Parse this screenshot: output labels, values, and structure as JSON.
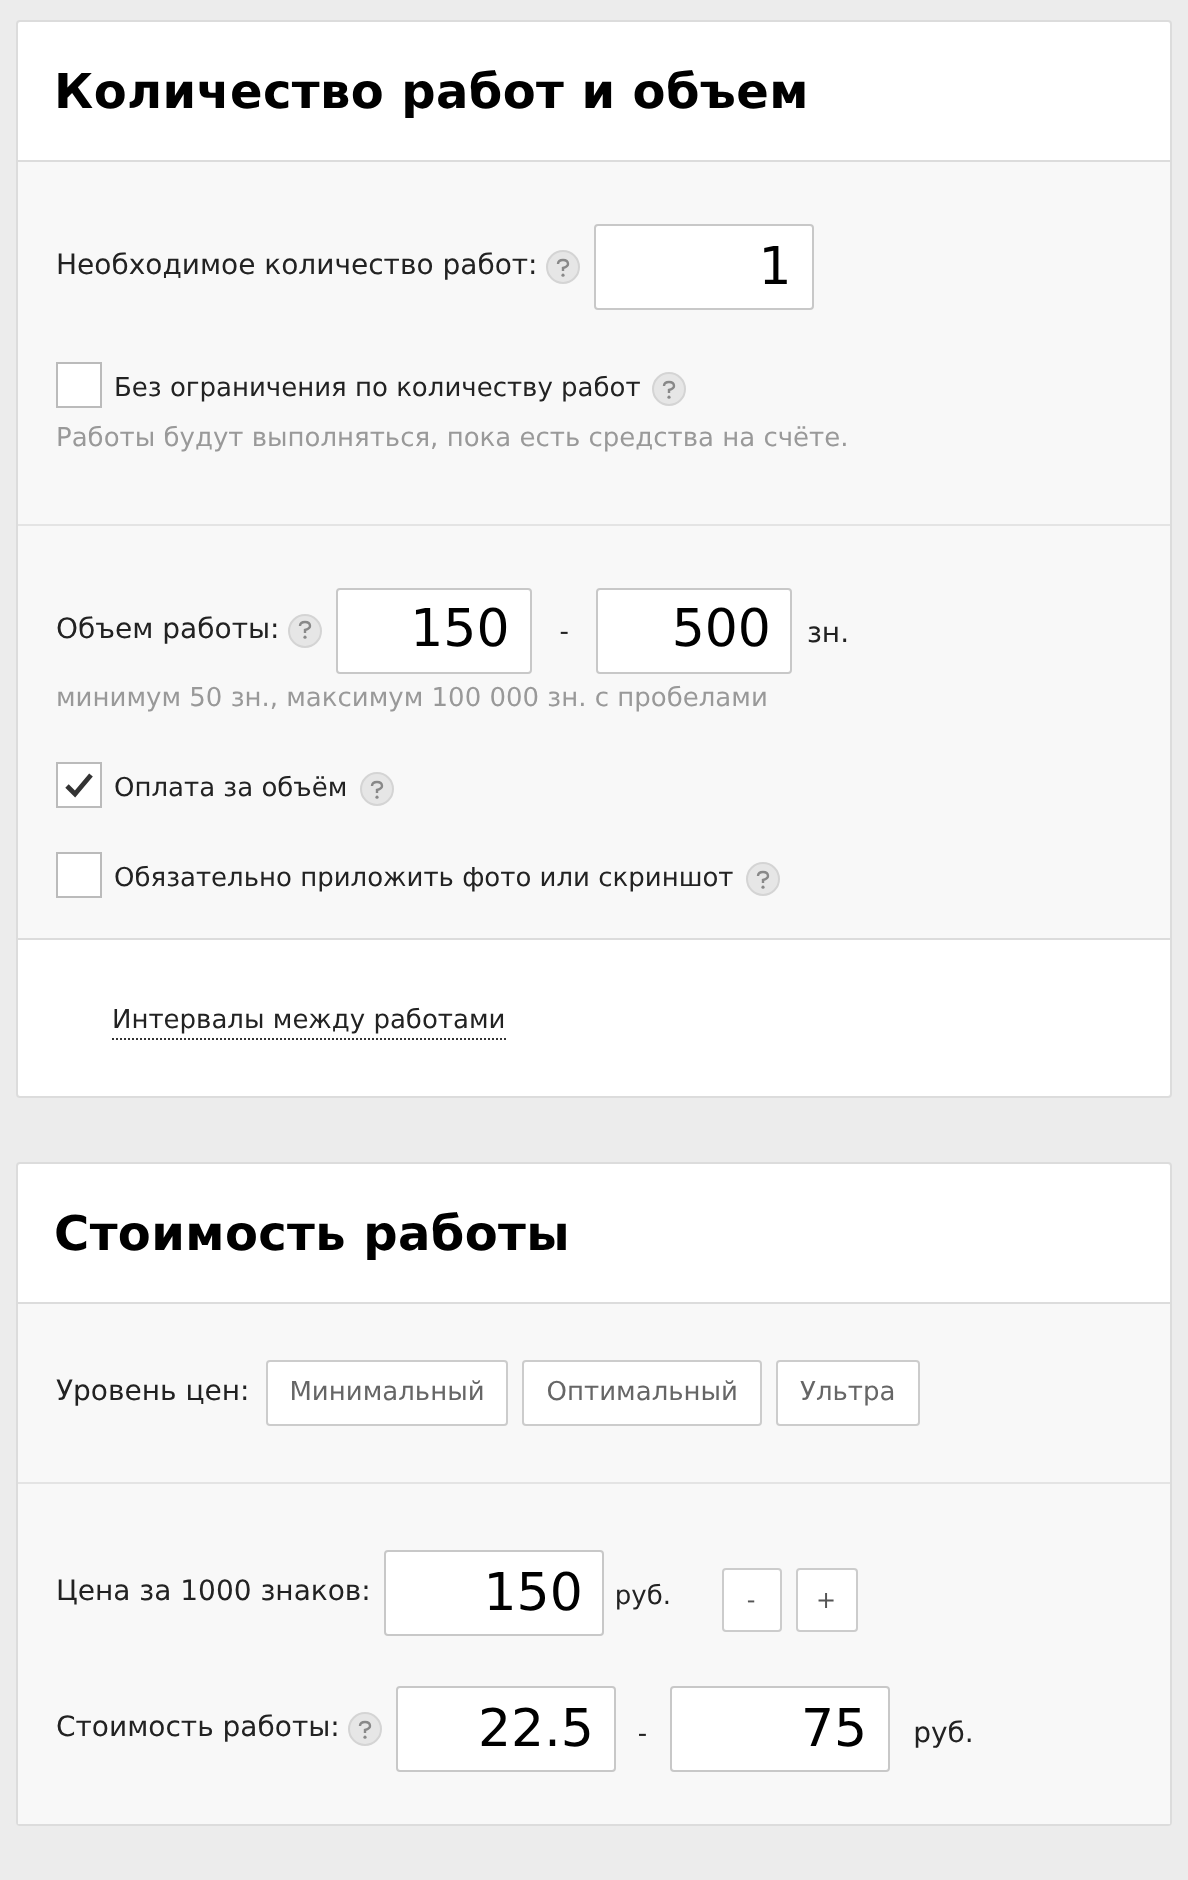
{
  "volume_card": {
    "title": "Количество работ и объем",
    "works_count": {
      "label": "Необходимое количество работ:",
      "value": "1"
    },
    "unlimited": {
      "label": "Без ограничения по количеству работ",
      "checked": false,
      "hint": "Работы будут выполняться, пока есть средства на счёте."
    },
    "volume": {
      "label": "Объем работы:",
      "from": "150",
      "separator": "-",
      "to": "500",
      "unit": "зн.",
      "hint": "минимум 50 зн., максимум 100 000 зн. с пробелами"
    },
    "options": [
      {
        "label": "Оплата за объём",
        "checked": true
      },
      {
        "label": "Обязательно приложить фото или скриншот",
        "checked": false
      }
    ],
    "intervals_link": "Интервалы между работами"
  },
  "price_card": {
    "title": "Стоимость работы",
    "level_label": "Уровень цен:",
    "levels": [
      {
        "label": "Минимальный",
        "selected": false
      },
      {
        "label": "Оптимальный",
        "selected": false
      },
      {
        "label": "Ультра",
        "selected": false
      }
    ],
    "price_per_1000": {
      "label": "Цена за 1000 знаков:",
      "value": "150",
      "unit": "руб.",
      "decrement": "-",
      "increment": "+"
    },
    "cost": {
      "label": "Стоимость работы:",
      "from": "22.5",
      "separator": "-",
      "to": "75",
      "unit": "руб."
    }
  }
}
